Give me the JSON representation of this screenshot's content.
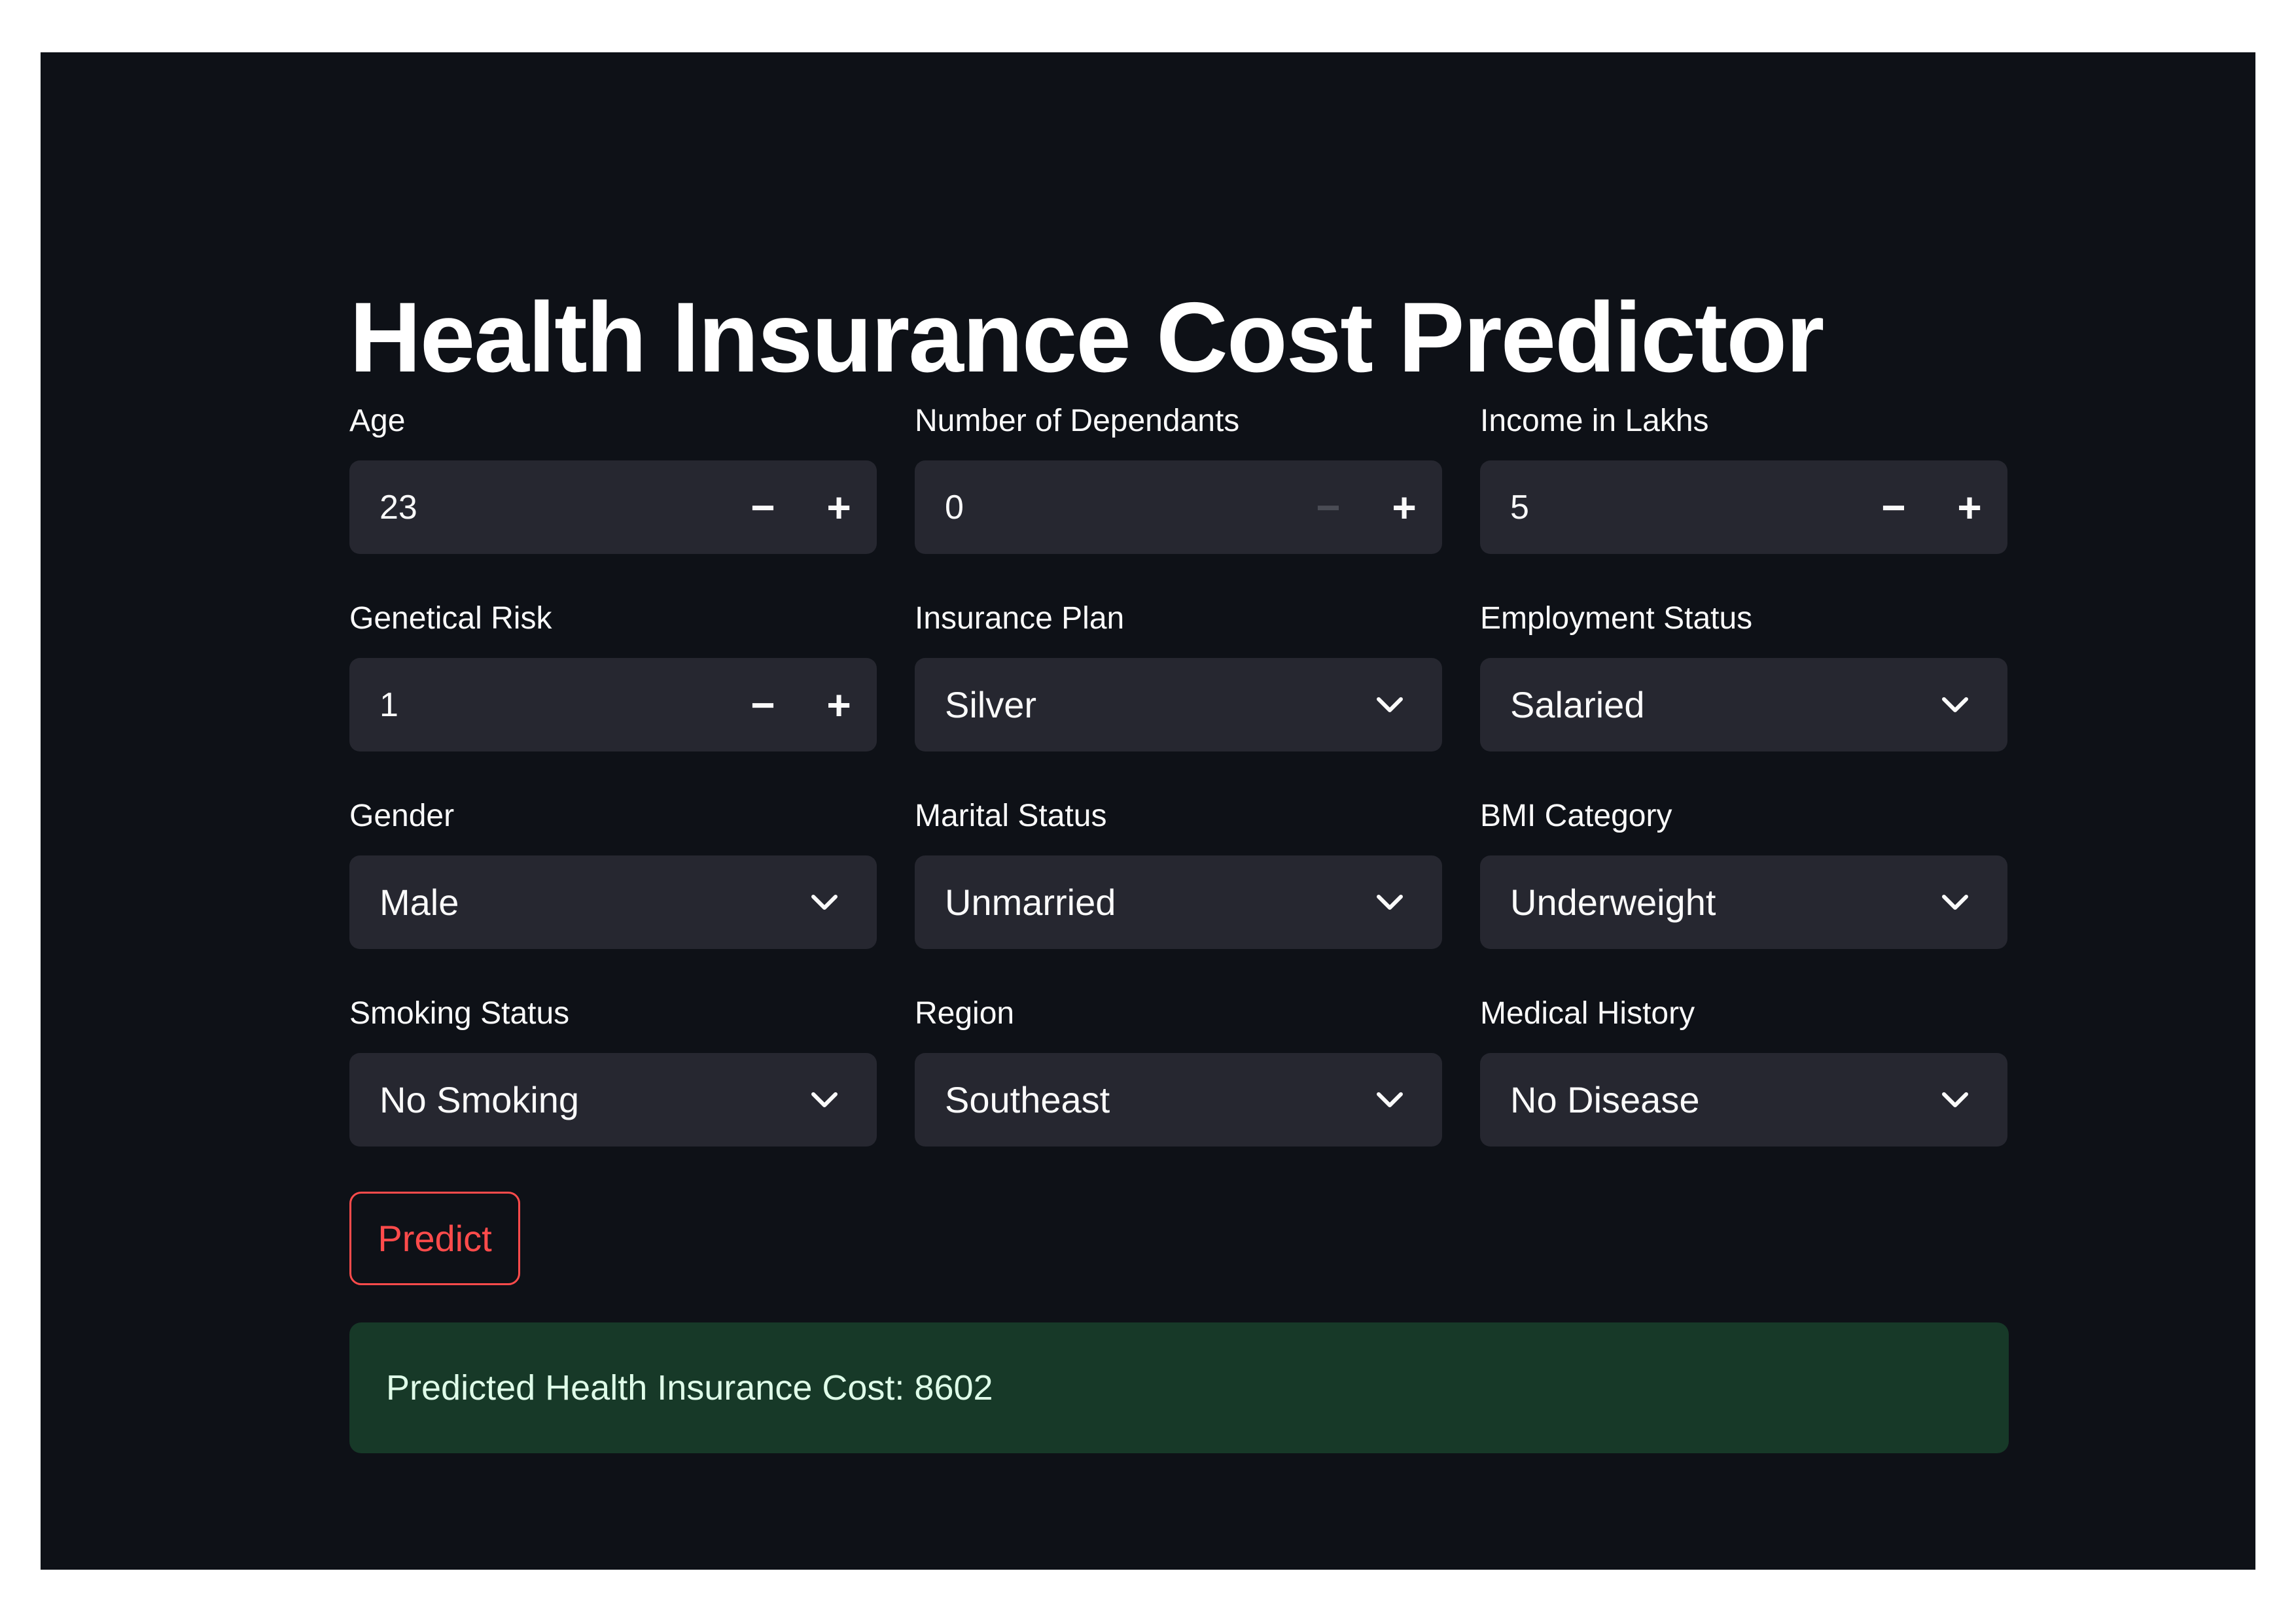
{
  "title": "Health Insurance Cost Predictor",
  "number_inputs": [
    {
      "label": "Age",
      "value": "23",
      "decrement": "−",
      "increment": "+",
      "decrement_disabled": false
    },
    {
      "label": "Number of Dependants",
      "value": "0",
      "decrement": "−",
      "increment": "+",
      "decrement_disabled": true
    },
    {
      "label": "Income in Lakhs",
      "value": "5",
      "decrement": "−",
      "increment": "+",
      "decrement_disabled": false
    },
    {
      "label": "Genetical Risk",
      "value": "1",
      "decrement": "−",
      "increment": "+",
      "decrement_disabled": false
    }
  ],
  "selects": [
    {
      "label": "Insurance Plan",
      "value": "Silver",
      "icon": "chevron-down-icon"
    },
    {
      "label": "Employment Status",
      "value": "Salaried",
      "icon": "chevron-down-icon"
    },
    {
      "label": "Gender",
      "value": "Male",
      "icon": "chevron-down-icon"
    },
    {
      "label": "Marital Status",
      "value": "Unmarried",
      "icon": "chevron-down-icon"
    },
    {
      "label": "BMI Category",
      "value": "Underweight",
      "icon": "chevron-down-icon"
    },
    {
      "label": "Smoking Status",
      "value": "No Smoking",
      "icon": "chevron-down-icon"
    },
    {
      "label": "Region",
      "value": "Southeast",
      "icon": "chevron-down-icon"
    },
    {
      "label": "Medical History",
      "value": "No Disease",
      "icon": "chevron-down-icon"
    }
  ],
  "predict_button": {
    "label": "Predict"
  },
  "result": {
    "text": "Predicted Health Insurance Cost: 8602"
  },
  "colors": {
    "background": "#0e1117",
    "input_background": "#262730",
    "accent": "#ff4b4b",
    "success_background": "#173928",
    "success_text": "#dffde9"
  }
}
